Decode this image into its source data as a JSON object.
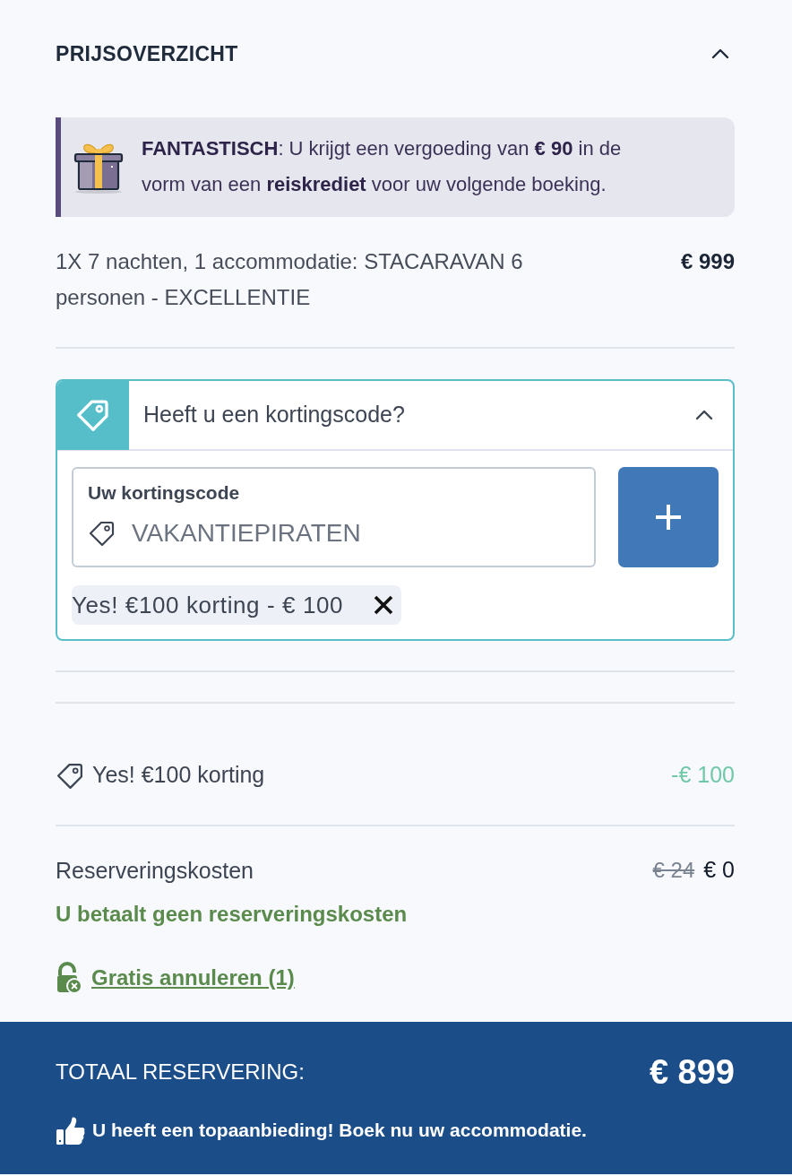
{
  "header": {
    "title": "PRIJSOVERZICHT",
    "expanded": true
  },
  "promo": {
    "text": "**FANTASTISCH**: U krijgt een vergoeding van **€ 90** in de vorm van een **reiskrediet** voor uw volgende boeking."
  },
  "line_items": [
    {
      "description": "1X 7 nachten, 1 accommodatie: STACARAVAN 6 personen - EXCELLENTIE",
      "price": "€ 999"
    }
  ],
  "discount_panel": {
    "title": "Heeft u een kortingscode?",
    "expanded": true,
    "field": {
      "label": "Uw kortingscode",
      "placeholder": "VAKANTIEPIRATEN"
    },
    "applied_codes": [
      {
        "text": "Yes! €100 korting - € 100"
      }
    ]
  },
  "discounts": [
    {
      "label": "Yes! €100 korting",
      "amount": "-€ 100"
    }
  ],
  "booking_fee": {
    "label": "Reserveringskosten",
    "old_price": "€ 24",
    "price": "€ 0",
    "note": "U betaalt geen reserveringskosten"
  },
  "cancellation_link": "Gratis annuleren (1)",
  "total": {
    "label": "TOTAAL RESERVERING:",
    "amount": "€ 899",
    "message": "U heeft een topaanbieding! Boek nu uw accommodatie."
  }
}
